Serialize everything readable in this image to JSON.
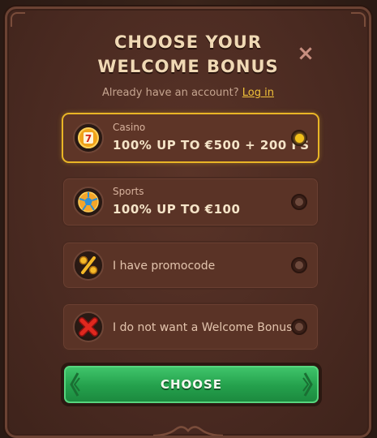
{
  "modal": {
    "title_line1": "CHOOSE YOUR",
    "title_line2": "WELCOME BONUS",
    "close_symbol": "×",
    "subtitle_text": "Already have an account?",
    "login_link": "Log in"
  },
  "options": [
    {
      "small": "Casino",
      "big": "100% UP TO €500 + 200 FS",
      "icon": "slot-777-icon",
      "selected": true
    },
    {
      "small": "Sports",
      "big": "100% UP TO €100",
      "icon": "soccer-ball-icon",
      "selected": false
    },
    {
      "label": "I have promocode",
      "icon": "percent-icon",
      "selected": false
    },
    {
      "label": "I do not want a Welcome Bonus",
      "icon": "red-cross-icon",
      "selected": false
    }
  ],
  "choose_button": {
    "label": "CHOOSE"
  },
  "colors": {
    "accent_gold": "#e9b526",
    "button_green": "#24a04c",
    "panel_brown": "#4a2a21",
    "link_yellow": "#f2c23a"
  }
}
